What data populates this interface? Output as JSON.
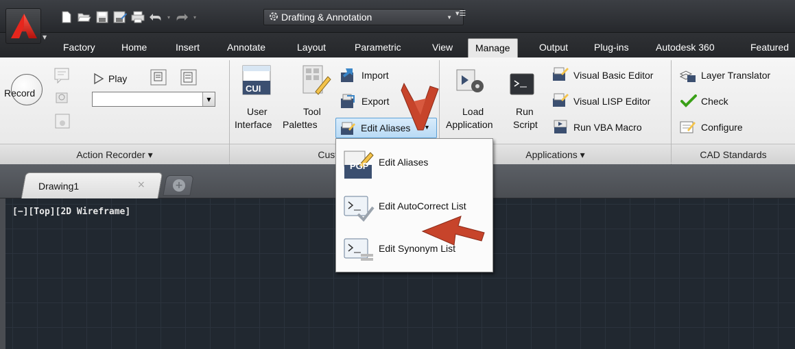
{
  "colors": {
    "accent_red": "#c9302c",
    "annotation_arrow": "#c7442b",
    "ribbon_bg": "#ececec",
    "dark_chrome": "#2b2d31",
    "canvas_bg": "#212830",
    "highlight": "#cfe6fa"
  },
  "quick_access": {
    "icons": [
      "new-icon",
      "open-icon",
      "save-icon",
      "save-as-icon",
      "plot-icon",
      "undo-icon",
      "redo-icon"
    ],
    "workspace": "Drafting & Annotation"
  },
  "tabs": [
    {
      "label": "Factory"
    },
    {
      "label": "Home"
    },
    {
      "label": "Insert"
    },
    {
      "label": "Annotate"
    },
    {
      "label": "Layout"
    },
    {
      "label": "Parametric"
    },
    {
      "label": "View"
    },
    {
      "label": "Manage",
      "active": true
    },
    {
      "label": "Output"
    },
    {
      "label": "Plug-ins"
    },
    {
      "label": "Autodesk 360"
    },
    {
      "label": "Featured"
    }
  ],
  "ribbon": {
    "action_recorder": {
      "record_label": "Record",
      "play_label": "Play",
      "panel_title": "Action Recorder ▾"
    },
    "customization": {
      "cui_badge": "CUI",
      "user_interface_line1": "User",
      "user_interface_line2": "Interface",
      "tool_palettes_line1": "Tool",
      "tool_palettes_line2": "Palettes",
      "import_label": "Import",
      "export_label": "Export",
      "edit_aliases_label": "Edit Aliases",
      "panel_title": "Custom"
    },
    "applications": {
      "load_line1": "Load",
      "load_line2": "Application",
      "run_line1": "Run",
      "run_line2": "Script",
      "vba_editor_label": "Visual Basic Editor",
      "lisp_editor_label": "Visual LISP Editor",
      "run_vba_label": "Run VBA Macro",
      "panel_title": "Applications ▾"
    },
    "cad_standards": {
      "layer_translator_label": "Layer Translator",
      "check_label": "Check",
      "configure_label": "Configure",
      "panel_title": "CAD Standards"
    }
  },
  "alias_menu": {
    "items": [
      {
        "label": "Edit Aliases",
        "icon_text": "PGP"
      },
      {
        "label": "Edit AutoCorrect List"
      },
      {
        "label": "Edit Synonym List"
      }
    ]
  },
  "document": {
    "tab_label": "Drawing1",
    "close_glyph": "×",
    "new_tab_glyph": "+"
  },
  "viewport": {
    "label": "[−][Top][2D Wireframe]"
  }
}
